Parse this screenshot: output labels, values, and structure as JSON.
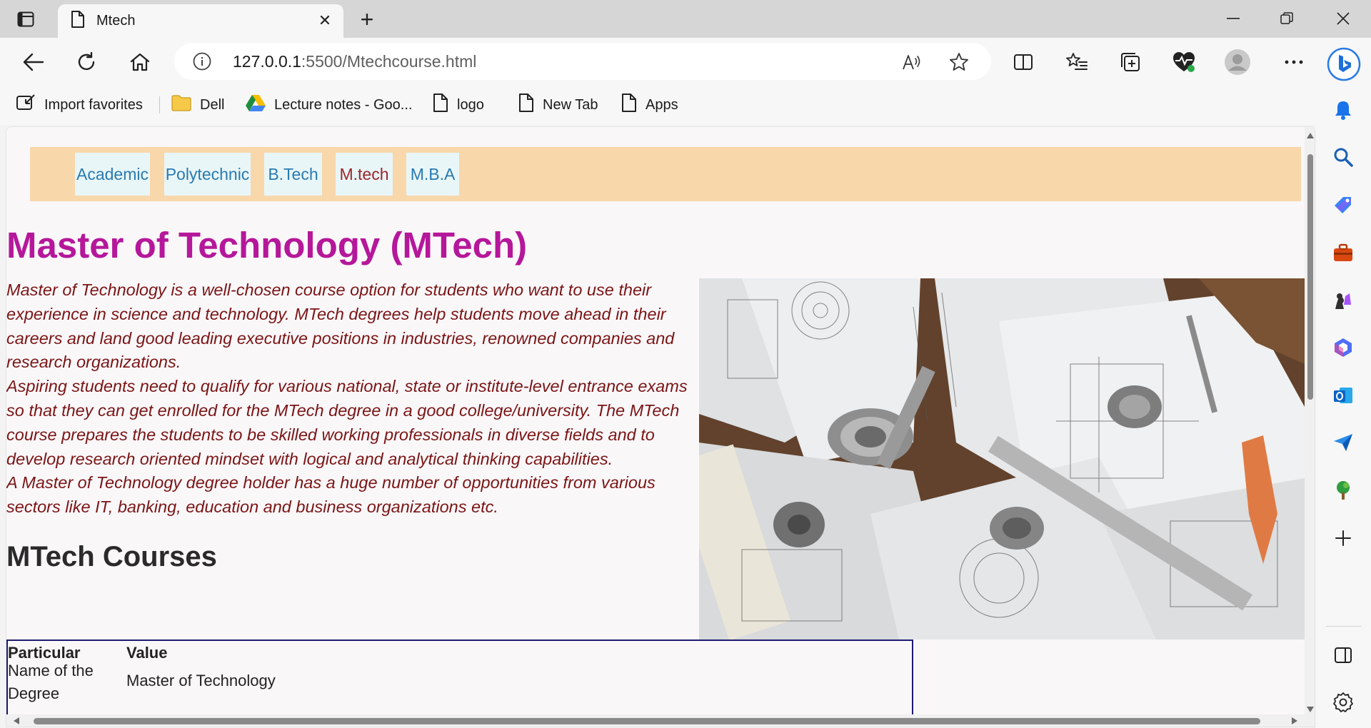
{
  "browser": {
    "tab": {
      "title": "Mtech",
      "icon": "document-icon",
      "close_glyph": "✕"
    },
    "new_tab_glyph": "+",
    "address": {
      "host": "127.0.0.1",
      "path": ":5500/Mtechcourse.html"
    },
    "favorites": [
      {
        "label": "Import favorites",
        "icon": "import-icon"
      },
      {
        "label": "Dell",
        "icon": "folder-icon"
      },
      {
        "label": "Lecture notes - Goo...",
        "icon": "google-drive-icon"
      },
      {
        "label": "logo",
        "icon": "document-icon"
      },
      {
        "label": "New Tab",
        "icon": "document-icon"
      },
      {
        "label": "Apps",
        "icon": "document-icon"
      }
    ],
    "sidebar_icons": [
      "bing-icon",
      "bell-icon",
      "search-icon",
      "shopping-tag-icon",
      "tools-icon",
      "games-icon",
      "office-icon",
      "outlook-icon",
      "send-icon",
      "tree-icon",
      "add-icon",
      "split-panel-icon",
      "settings-icon"
    ]
  },
  "page": {
    "nav": [
      {
        "label": "Academic",
        "active": false
      },
      {
        "label": "Polytechnic",
        "active": false
      },
      {
        "label": "B.Tech",
        "active": false
      },
      {
        "label": "M.tech",
        "active": true
      },
      {
        "label": "M.B.A",
        "active": false
      }
    ],
    "title": "Master of Technology (MTech)",
    "intro": [
      "Master of Technology is a well-chosen course option for students who want to use their experience in science and technology. MTech degrees help students move ahead in their careers and land good leading executive positions in industries, renowned companies and research organizations.",
      "Aspiring students need to qualify for various national, state or institute-level entrance exams so that they can get enrolled for the MTech degree in a good college/university. The MTech course prepares the students to be skilled working professionals in diverse fields and to develop research oriented mindset with logical and analytical thinking capabilities.",
      "A Master of Technology degree holder has a huge number of opportunities from various sectors like IT, banking, education and business organizations etc."
    ],
    "courses_heading": "MTech Courses",
    "table": {
      "headers": [
        "Particular",
        "Value"
      ],
      "rows": [
        {
          "particular": "Name of the Degree",
          "value": "Master of Technology"
        }
      ]
    },
    "colors": {
      "title": "#b5179a",
      "intro_text": "#7a1515",
      "nav_bar": "#f8d7ab",
      "nav_link": "#2a7ab0",
      "nav_active": "#a02428"
    }
  }
}
